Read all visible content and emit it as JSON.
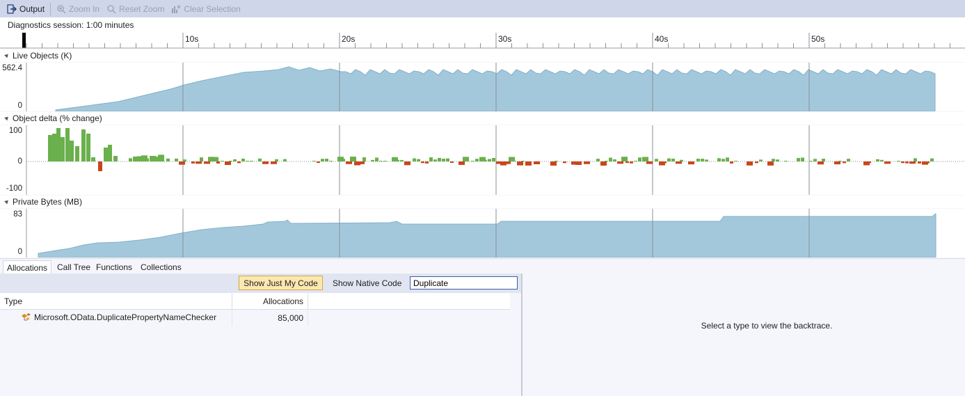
{
  "toolbar": {
    "output": "Output",
    "zoom_in": "Zoom In",
    "reset_zoom": "Reset Zoom",
    "clear_selection": "Clear Selection"
  },
  "session": {
    "label": "Diagnostics session: 1:00 minutes"
  },
  "ruler": {
    "ticks": [
      "10s",
      "20s",
      "30s",
      "40s",
      "50s"
    ]
  },
  "sections": {
    "live_objects": {
      "title": "Live Objects (K)",
      "ymax": "562.4",
      "ymin": "0"
    },
    "object_delta": {
      "title": "Object delta (% change)",
      "ymax": "100",
      "ymid": "0",
      "ymin": "-100"
    },
    "private_bytes": {
      "title": "Private Bytes (MB)",
      "ymax": "83",
      "ymin": "0"
    }
  },
  "colors": {
    "area_fill": "#a4c8db",
    "area_stroke": "#7fb0c8",
    "bar_pos": "#6ab04c",
    "bar_neg": "#c8461c",
    "accent": "#3c5fa3"
  },
  "tabs": [
    "Allocations",
    "Call Tree",
    "Functions",
    "Collections"
  ],
  "filter": {
    "just_my_code": "Show Just My Code",
    "native_code": "Show Native Code",
    "search_value": "Duplicate"
  },
  "grid": {
    "columns": [
      "Type",
      "Allocations"
    ],
    "rows": [
      {
        "type": "Microsoft.OData.DuplicatePropertyNameChecker",
        "allocations": "85,000",
        "icon": "class-icon"
      }
    ]
  },
  "backtrace": {
    "message": "Select a type to view the backtrace."
  }
}
